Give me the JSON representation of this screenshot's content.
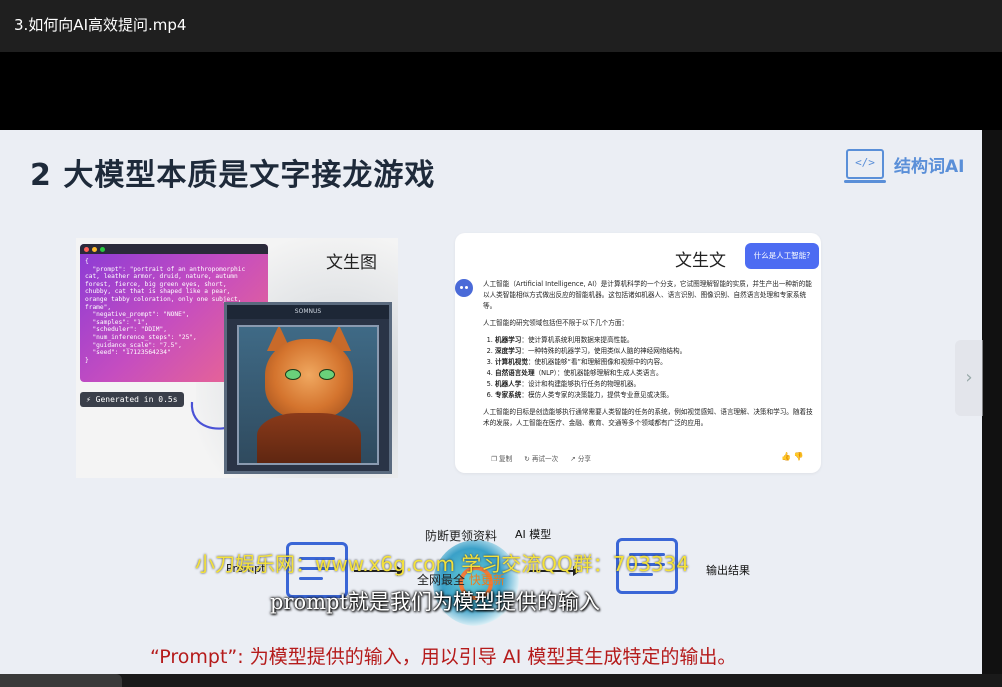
{
  "window": {
    "title": "3.如何向AI高效提问.mp4"
  },
  "slide": {
    "heading": "2  大模型本质是文字接龙游戏",
    "brand": {
      "icon": "code-monitor-icon",
      "icon_glyph": "</>",
      "text": "结构词AI"
    },
    "text_to_image": {
      "label": "文生图",
      "code_lines": [
        "{",
        "  \"prompt\": \"portrait of an anthropomorphic",
        "cat, leather armor, druid, nature, autumn",
        "forest, fierce, big green eyes, short,",
        "chubby, cat that is shaped like a pear,",
        "orange tabby coloration, only one subject,",
        "frame\",",
        "  \"negative_prompt\": \"NONE\",",
        "  \"samples\": \"1\",",
        "  \"scheduler\": \"DDIM\",",
        "  \"num_inference_steps\": \"25\",",
        "  \"guidance_scale\": \"7.5\",",
        "  \"seed\": \"17123564234\"",
        "}"
      ],
      "generated_badge": "Generated in 0.5s",
      "frame_header": "SOMNUS"
    },
    "text_to_text": {
      "label": "文生文",
      "question": "什么是人工智能?",
      "intro": "人工智能（Artificial Intelligence, AI）是计算机科学的一个分支，它试图理解智能的实质，并生产出一种新的能以人类智能相似方式做出反应的智能机器。这包括诸如机器人、语言识别、图像识别、自然语言处理和专家系统等。",
      "lead": "人工智能的研究领域包括但不限于以下几个方面：",
      "items": [
        {
          "term": "机器学习",
          "desc": "：使计算机系统利用数据来提高性能。"
        },
        {
          "term": "深度学习",
          "desc": "：一种特殊的机器学习，使用类似人脑的神经网络结构。"
        },
        {
          "term": "计算机视觉",
          "desc": "：使机器能够“看”和理解图像和视频中的内容。"
        },
        {
          "term": "自然语言处理",
          "desc": "（NLP）：使机器能够理解和生成人类语言。"
        },
        {
          "term": "机器人学",
          "desc": "：设计和构建能够执行任务的物理机器。"
        },
        {
          "term": "专家系统",
          "desc": "：模仿人类专家的决策能力，提供专业意见或决策。"
        }
      ],
      "outro": "人工智能的目标是创造能够执行通常需要人类智能的任务的系统，例如视觉感知、语言理解、决策和学习。随着技术的发展，人工智能在医疗、金融、教育、交通等多个领域都有广泛的应用。",
      "actions": {
        "copy": "复制",
        "retry": "再试一次",
        "share": "分享"
      }
    },
    "flow": {
      "input_label": "Prompt",
      "model_label": "AI 模型",
      "output_label": "输出结果"
    },
    "caption": "“Prompt”: 为模型提供的输入，用以引导 AI 模型其生成特定的输出。"
  },
  "overlays": {
    "watermark_site": "小刀娱乐网：www.x6g.com  学习交流QQ群：703334",
    "watermark_top": "防断更领资料",
    "watermark_bottom_a": "全网最全",
    "watermark_bottom_b": "快更新",
    "subtitle": "prompt就是我们为模型提供的输入"
  },
  "colors": {
    "accent": "#3a66d6",
    "caption": "#b51b1b",
    "button": "#4d6cf2"
  }
}
